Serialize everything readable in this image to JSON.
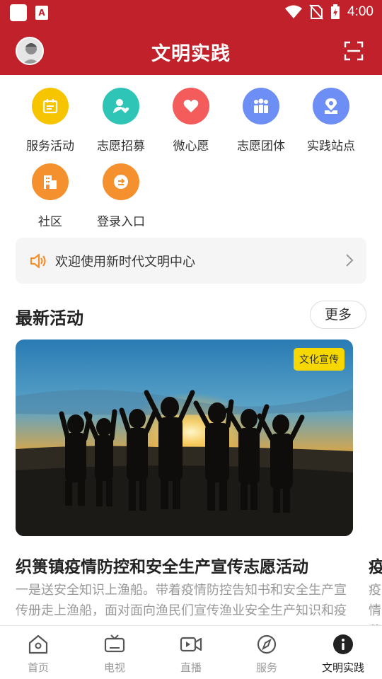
{
  "status_bar": {
    "time": "4:00"
  },
  "header": {
    "title": "文明实践"
  },
  "grid": [
    {
      "label": "服务活动",
      "color": "#f7c400",
      "icon": "calendar-icon"
    },
    {
      "label": "志愿招募",
      "color": "#2ec4b6",
      "icon": "person-heart-icon"
    },
    {
      "label": "微心愿",
      "color": "#f45b5b",
      "icon": "heart-icon"
    },
    {
      "label": "志愿团体",
      "color": "#6d8ef5",
      "icon": "group-icon"
    },
    {
      "label": "实践站点",
      "color": "#6d8ef5",
      "icon": "location-icon"
    },
    {
      "label": "社区",
      "color": "#f5902f",
      "icon": "building-icon"
    },
    {
      "label": "登录入口",
      "color": "#f5902f",
      "icon": "login-icon"
    }
  ],
  "notice": {
    "text": "欢迎使用新时代文明中心"
  },
  "section": {
    "title": "最新活动",
    "more": "更多"
  },
  "card": {
    "tag": "文化宣传",
    "title": "织篑镇疫情防控和安全生产宣传志愿活动",
    "desc": "一是送安全知识上渔船。带着疫情防控告知书和安全生产宣传册走上渔船，面对面向渔民们宣传渔业安全生产知识和疫情防控知识，提醒渔民要时刻做好疫情"
  },
  "peek_card": {
    "title": "疫",
    "desc": "疫情 蒲岐"
  },
  "bottom_nav": [
    {
      "label": "首页",
      "icon": "home-icon"
    },
    {
      "label": "电视",
      "icon": "tv-icon"
    },
    {
      "label": "直播",
      "icon": "live-icon"
    },
    {
      "label": "服务",
      "icon": "compass-icon"
    },
    {
      "label": "文明实践",
      "icon": "info-icon"
    }
  ],
  "colors": {
    "brand": "#c0212a",
    "tag": "#f6d800"
  }
}
